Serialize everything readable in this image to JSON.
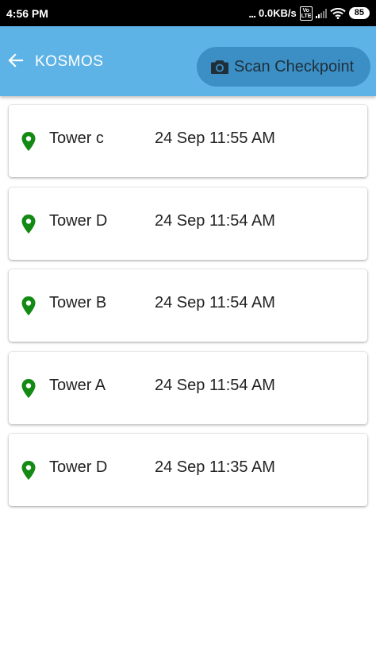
{
  "status_bar": {
    "time": "4:56 PM",
    "dots": "...",
    "net_speed": "0.0KB/s",
    "volte": "Vo LTE",
    "battery": "85"
  },
  "app_bar": {
    "title": "KOSMOS",
    "scan_button_label": "Scan Checkpoint"
  },
  "colors": {
    "app_bar": "#5eb3e6",
    "scan_button": "#3b8fc5",
    "pin": "#138a13"
  },
  "checkpoints": [
    {
      "tower": "Tower c",
      "time": "24 Sep 11:55 AM",
      "icon": "location-pin-icon"
    },
    {
      "tower": "Tower D",
      "time": "24 Sep 11:54 AM",
      "icon": "location-pin-icon"
    },
    {
      "tower": "Tower B",
      "time": "24 Sep 11:54 AM",
      "icon": "location-pin-icon"
    },
    {
      "tower": "Tower A",
      "time": "24 Sep 11:54 AM",
      "icon": "location-pin-icon"
    },
    {
      "tower": "Tower D",
      "time": "24 Sep 11:35 AM",
      "icon": "location-pin-icon"
    }
  ]
}
